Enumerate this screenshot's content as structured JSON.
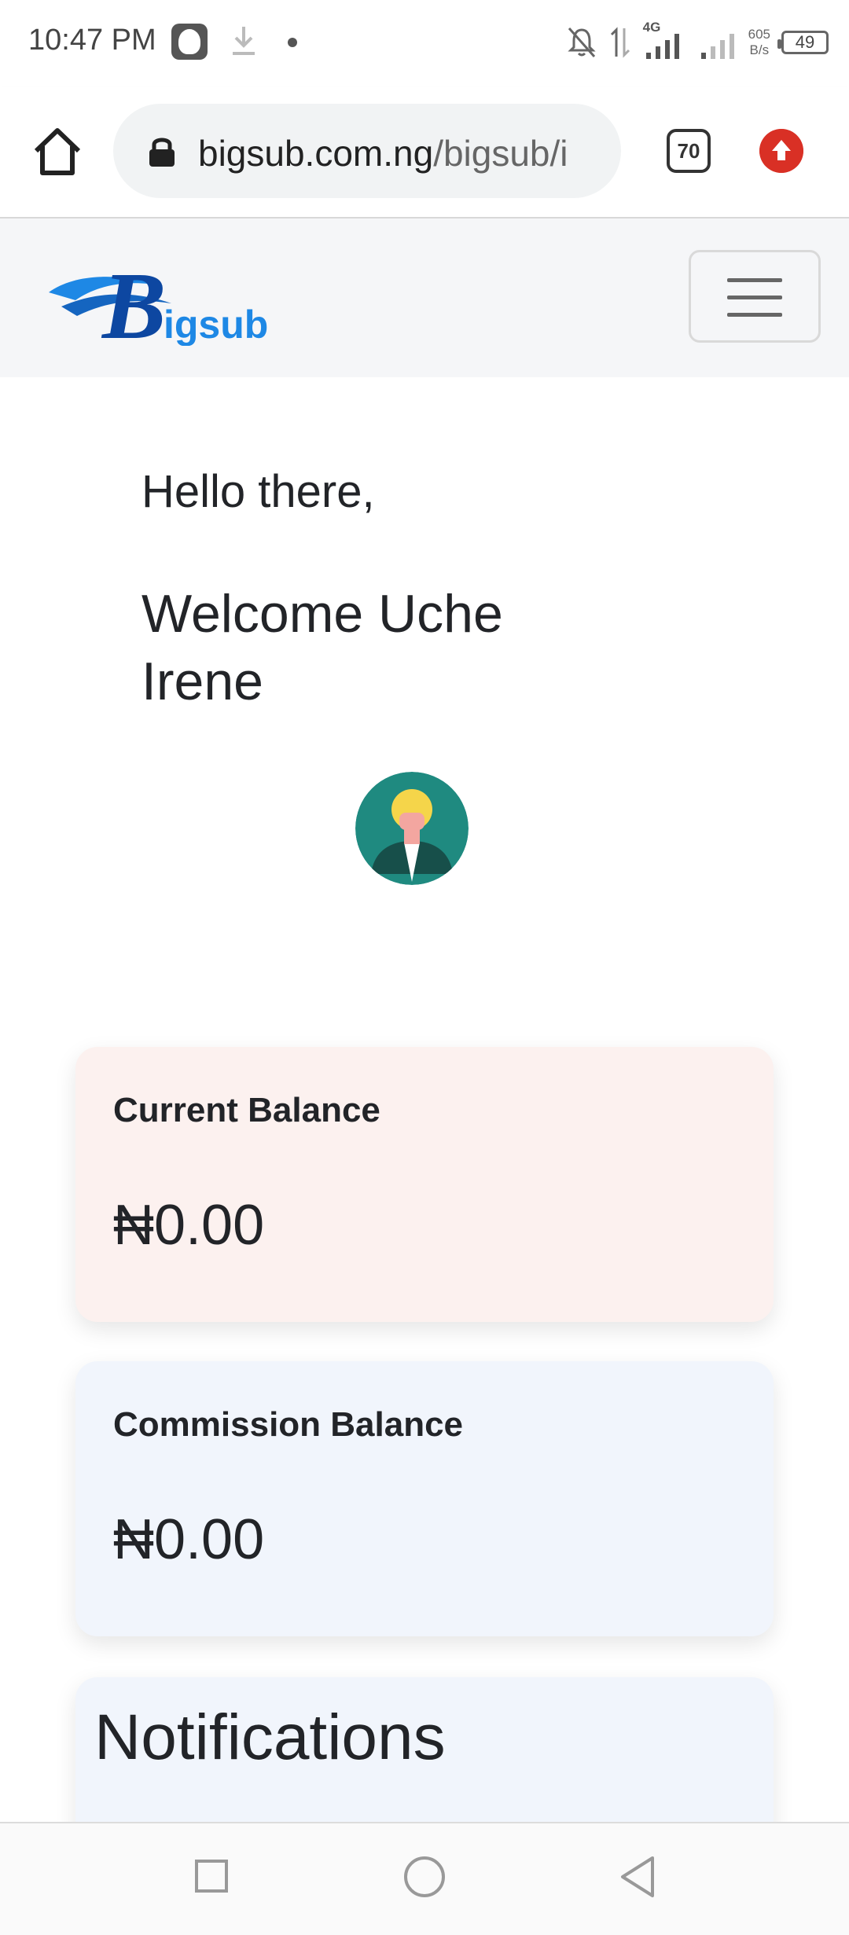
{
  "status_bar": {
    "time": "10:47 PM",
    "network": "4G",
    "speed_value": "605",
    "speed_unit": "B/s",
    "battery": "49"
  },
  "browser": {
    "url_domain": "bigsub.com.ng",
    "url_path": "/bigsub/i",
    "tab_count": "70"
  },
  "site": {
    "logo_text": "igsub",
    "logo_letter": "B",
    "brand_color": "#1565c0"
  },
  "greeting": {
    "hello": "Hello there,",
    "welcome": "Welcome Uche Irene"
  },
  "cards": {
    "current_balance_label": "Current Balance",
    "current_balance_value": "₦0.00",
    "commission_balance_label": "Commission Balance",
    "commission_balance_value": "₦0.00",
    "notifications_title": "Notifications"
  },
  "colors": {
    "balance_card_bg": "#fcf1ef",
    "commission_card_bg": "#f1f5fc",
    "update_badge": "#d93025"
  },
  "icons": [
    "home-icon",
    "lock-icon",
    "tabs-icon",
    "update-icon",
    "menu-icon",
    "avatar-icon",
    "recents-icon",
    "home-circle-icon",
    "back-icon"
  ]
}
